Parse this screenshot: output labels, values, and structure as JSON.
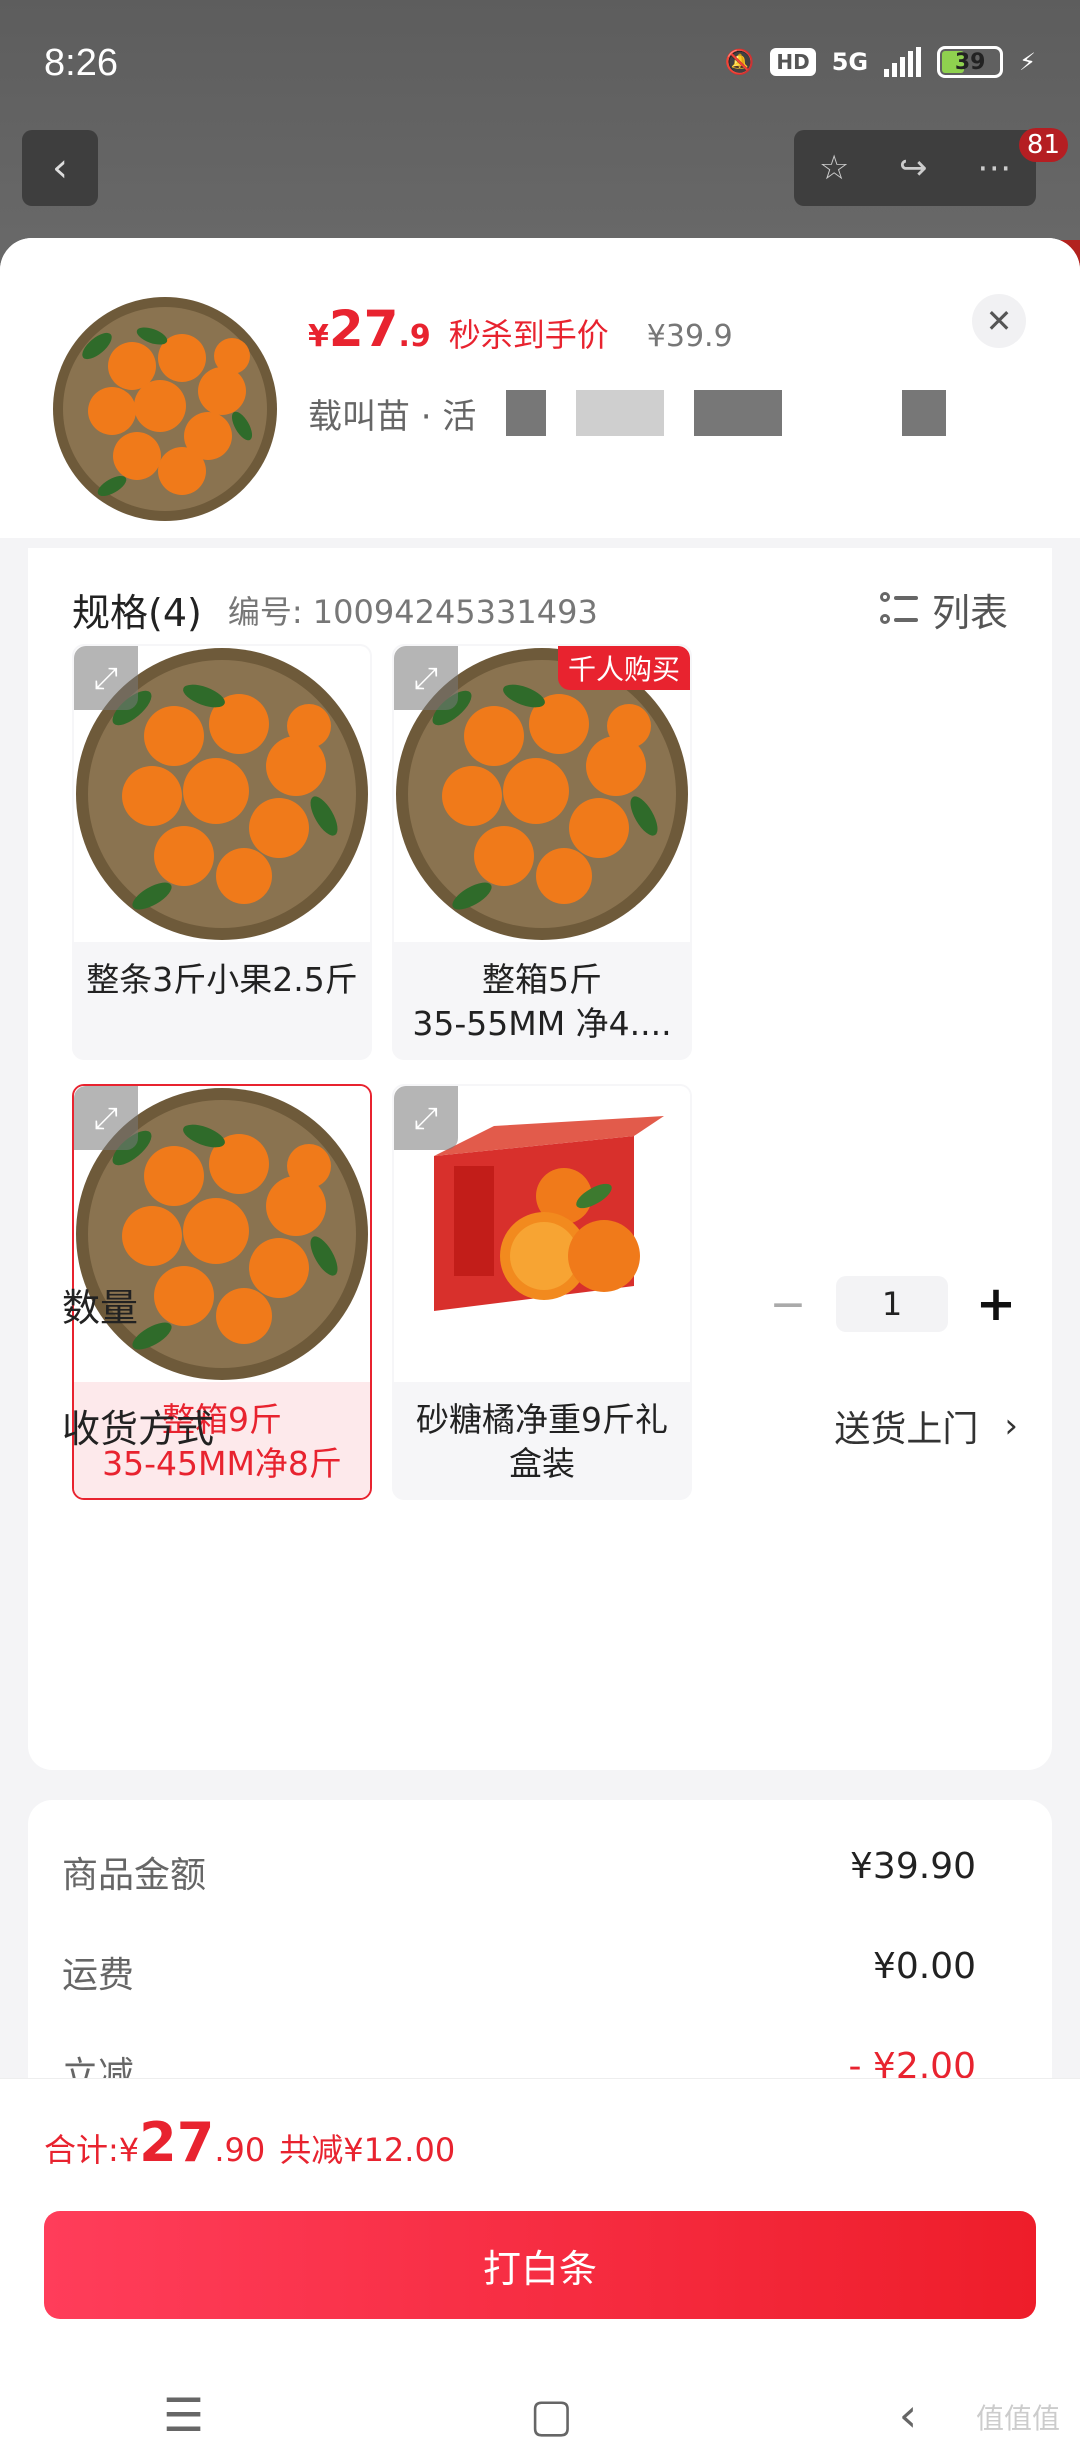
{
  "status_bar": {
    "time": "8:26",
    "network": "5G",
    "hd": "HD",
    "battery": "39"
  },
  "top_nav": {
    "back_icon": "chevron-left-icon",
    "badge_count": "81"
  },
  "product": {
    "price_symbol": "¥",
    "price_int": "27",
    "price_dec": ".9",
    "price_tag": "秒杀到手价",
    "original_price": "¥39.9",
    "name_visible": "载叫苗 · 活"
  },
  "spec": {
    "title": "规格(4)",
    "code": "编号: 10094245331493",
    "list_label": "列表",
    "items": [
      {
        "label": "整条3斤小果2.5斤",
        "selected": false,
        "tag": ""
      },
      {
        "label": "整箱5斤\n35-55MM 净4....",
        "selected": false,
        "tag": "千人购买"
      },
      {
        "label": "整箱9斤\n35-45MM净8斤",
        "selected": true,
        "tag": ""
      },
      {
        "label": "砂糖橘净重9斤礼\n盒装",
        "selected": false,
        "tag": ""
      }
    ]
  },
  "quantity": {
    "label": "数量",
    "minus": "−",
    "value": "1",
    "plus": "+"
  },
  "delivery": {
    "label": "收货方式",
    "value": "送货上门",
    "chevron": "›"
  },
  "costs": {
    "rows": [
      {
        "label": "商品金额",
        "value": "¥39.90"
      },
      {
        "label": "运费",
        "value": "¥0.00"
      },
      {
        "label": "立减",
        "value": "- ¥2.00"
      }
    ]
  },
  "checkout": {
    "total_label": "合计: ",
    "total_symbol": "¥",
    "total_int": "27",
    "total_dec": ".90",
    "saved": "共减¥12.00",
    "pay_button": "打白条"
  },
  "system_nav": {
    "menu": "☰",
    "home": "▢",
    "back": "‹"
  },
  "watermark": "值值值",
  "colors": {
    "accent": "#e8232f",
    "button_start": "#ff3d5a",
    "button_end": "#ee1d2a"
  }
}
